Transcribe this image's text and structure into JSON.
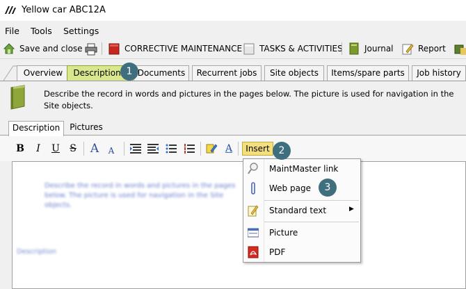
{
  "window": {
    "title": "Yellow car ABC12A"
  },
  "menu": [
    "File",
    "Tools",
    "Settings"
  ],
  "toolbar": {
    "save_close": "Save and close",
    "corrective": "CORRECTIVE MAINTENANCE",
    "tasks": "TASKS & ACTIVITIES",
    "journal": "Journal",
    "report": "Report"
  },
  "tabs": [
    "Overview",
    "Description",
    "Documents",
    "Recurrent jobs",
    "Site objects",
    "Items/spare parts",
    "Job history"
  ],
  "description": {
    "text": "Describe the record in words and pictures in the pages below. The picture is used for navigation in the Site objects."
  },
  "subtabs": [
    "Description",
    "Pictures"
  ],
  "format": {
    "bold": "B",
    "italic": "I",
    "underline": "U",
    "strike": "S",
    "grow": "A",
    "shrink": "A",
    "color": "A",
    "insert": "Insert"
  },
  "insert_menu": [
    "MaintMaster link",
    "Web page",
    "Standard text",
    "Picture",
    "PDF"
  ],
  "submenu_arrow": "▶",
  "badges": [
    "1",
    "2",
    "3"
  ],
  "colors": {
    "active_tab": "#d9e88f",
    "insert": "#f3df7d",
    "badge": "#3f6f7e"
  }
}
